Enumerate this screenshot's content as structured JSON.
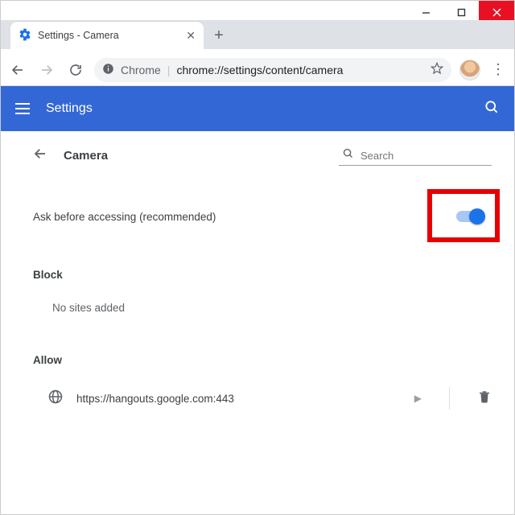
{
  "window": {
    "tab_title": "Settings - Camera"
  },
  "addressbar": {
    "scheme_label": "Chrome",
    "url": "chrome://settings/content/camera"
  },
  "header": {
    "title": "Settings"
  },
  "sub": {
    "title": "Camera",
    "search_placeholder": "Search"
  },
  "toggle": {
    "label": "Ask before accessing (recommended)",
    "on": true
  },
  "sections": {
    "block_label": "Block",
    "block_empty": "No sites added",
    "allow_label": "Allow",
    "allow_items": [
      {
        "url": "https://hangouts.google.com:443"
      }
    ]
  }
}
